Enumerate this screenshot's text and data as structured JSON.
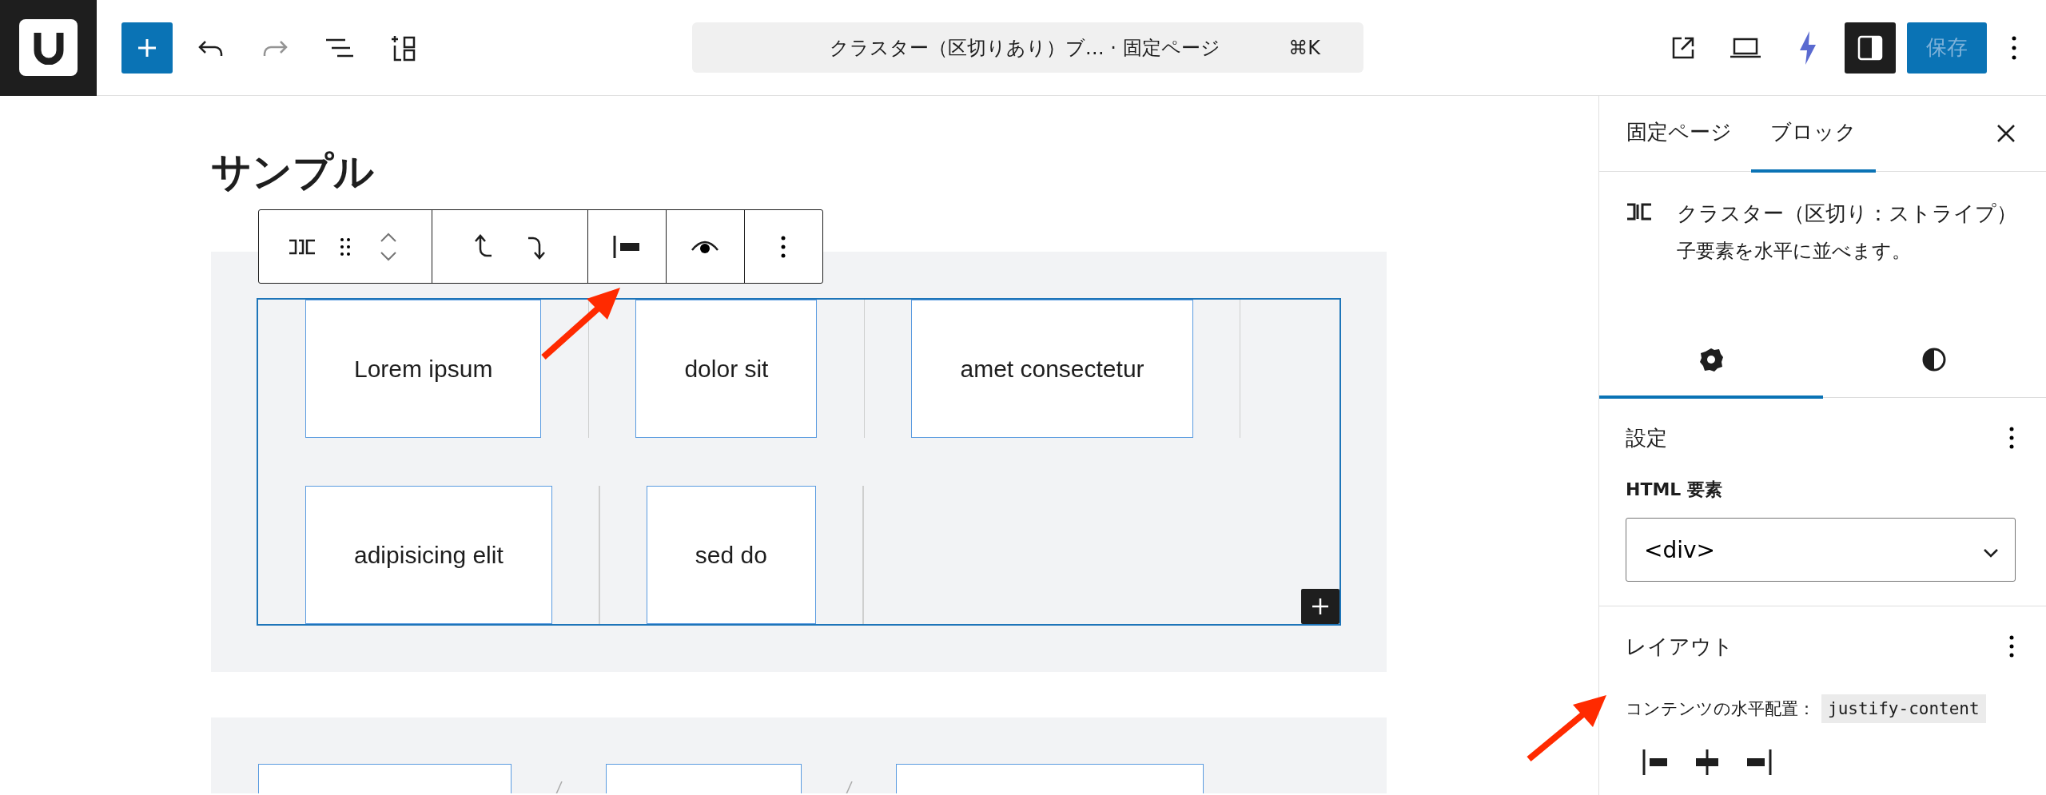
{
  "top_bar": {
    "redo": {
      "disabled": true
    },
    "command": {
      "title": "クラスター（区切りあり）ブ… · 固定ページ",
      "shortcut": "⌘K"
    },
    "sidebar_toggle": {
      "on": true
    },
    "save_button": {
      "label": "保存",
      "disabled": true
    }
  },
  "canvas": {
    "heading": "サンプル",
    "clusters": [
      {
        "selected": true,
        "kind": "line",
        "items": [
          {
            "label": "Lorem ipsum",
            "outlined": true
          },
          {
            "label": "dolor sit",
            "outlined": true
          },
          {
            "label": "amet consectetur",
            "outlined": true
          },
          {
            "label": "adipisicing elit",
            "outlined": true
          },
          {
            "label": "sed do",
            "outlined": true
          }
        ]
      },
      {
        "selected": false,
        "kind": "slash",
        "items": [
          {
            "outlined": true
          },
          {
            "outlined": true
          },
          {
            "outlined": true
          }
        ]
      }
    ]
  },
  "sidebar": {
    "tabs": [
      {
        "label": "固定ページ",
        "selected": false
      },
      {
        "label": "ブロック",
        "selected": true
      }
    ],
    "block": {
      "title": "クラスター（区切り：ストライプ）",
      "description": "子要素を水平に並べます。"
    },
    "panel_tabs": [
      {
        "kind": "settings",
        "selected": true
      },
      {
        "kind": "styles",
        "selected": false
      }
    ],
    "settings": {
      "title": "設定",
      "html_element": {
        "label": "HTML 要素",
        "value": "<div>"
      }
    },
    "layout": {
      "title": "レイアウト",
      "justify": {
        "label": "コンテンツの水平配置：",
        "code": "justify-content",
        "options": [
          {
            "kind": "left"
          },
          {
            "kind": "center"
          },
          {
            "kind": "right"
          }
        ]
      }
    }
  }
}
